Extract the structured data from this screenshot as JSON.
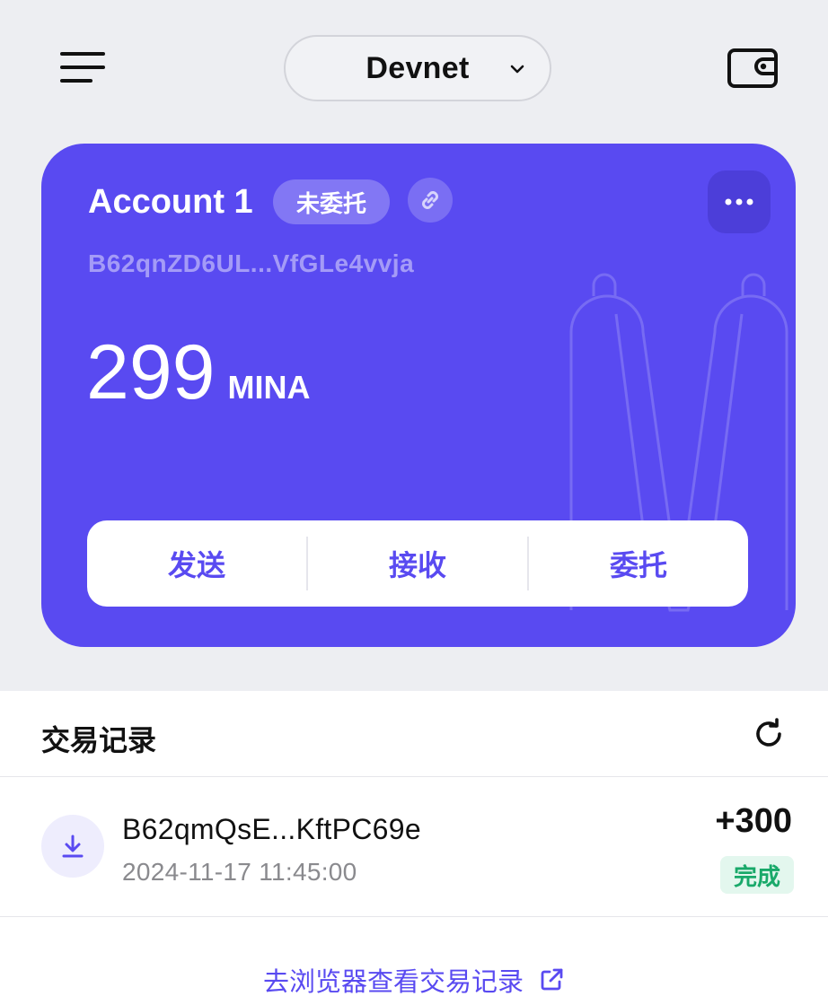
{
  "header": {
    "network": "Devnet"
  },
  "account": {
    "name": "Account 1",
    "delegation_status": "未委托",
    "address": "B62qnZD6UL...VfGLe4vvja",
    "balance": "299",
    "unit": "MINA"
  },
  "actions": {
    "send": "发送",
    "receive": "接收",
    "delegate": "委托"
  },
  "transactions": {
    "title": "交易记录",
    "items": [
      {
        "address": "B62qmQsE...KftPC69e",
        "time": "2024-11-17 11:45:00",
        "amount": "+300",
        "status": "完成"
      }
    ]
  },
  "explorer_link": "去浏览器查看交易记录",
  "colors": {
    "primary": "#594af1",
    "background": "#edeef2",
    "success": "#19a96a"
  },
  "icons": [
    "menu-icon",
    "chevron-down-icon",
    "wallet-icon",
    "link-icon",
    "more-icon",
    "refresh-icon",
    "download-icon",
    "external-link-icon"
  ]
}
